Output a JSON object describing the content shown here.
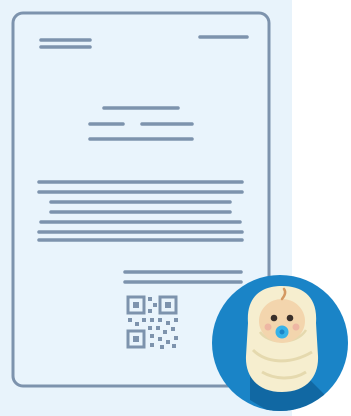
{
  "illustration": {
    "subject": "birth-certificate-document-with-baby-badge",
    "icons": [
      "document-icon",
      "qr-code-icon",
      "baby-icon"
    ],
    "colors": {
      "background_panel": "#e8f3fb",
      "document_fill": "#e9f4fc",
      "document_outline": "#7d93ad",
      "badge_blue": "#1a84c7",
      "badge_shadow": "#11659e",
      "swaddle": "#f6eecf",
      "skin": "#f3d5ad",
      "pacifier": "#37b2e8"
    }
  }
}
